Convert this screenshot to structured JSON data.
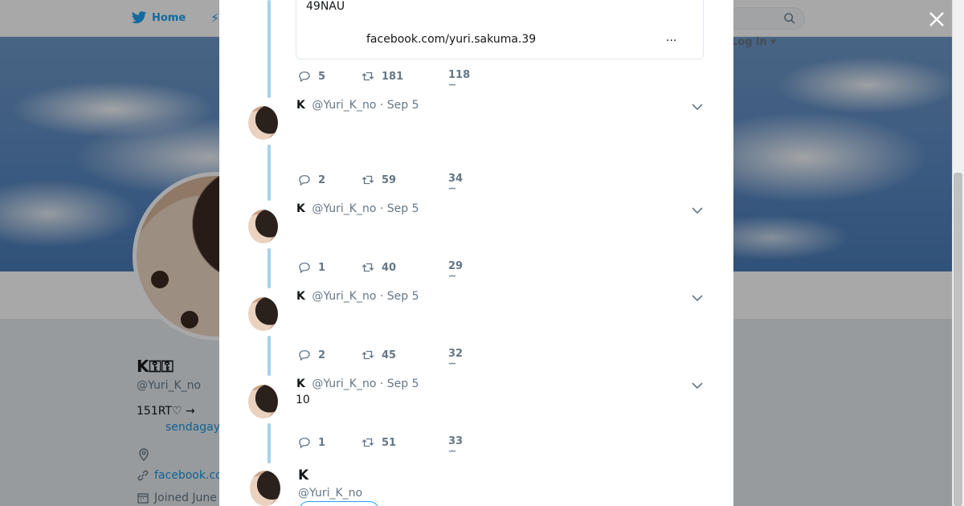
{
  "nav": {
    "home_label": "Home",
    "login_label": "Log in ▾"
  },
  "profile": {
    "name": "K⚿⚿",
    "handle": "@Yuri_K_no",
    "bio": "151RT♡ →",
    "bio_link": "sendagay",
    "url": "facebook.co",
    "joined": "Joined June"
  },
  "card": {
    "text": "49NAU",
    "link": "facebook.com/yuri.sakuma.39",
    "more": "..."
  },
  "tweets": [
    {
      "reply": "5",
      "retweet": "181",
      "like": "118"
    },
    {
      "name": "K",
      "handle": "@Yuri_K_no",
      "dot": "·",
      "date": "Sep 5",
      "body": "",
      "reply": "2",
      "retweet": "59",
      "like": "34"
    },
    {
      "name": "K",
      "handle": "@Yuri_K_no",
      "dot": "·",
      "date": "Sep 5",
      "body": "",
      "reply": "1",
      "retweet": "40",
      "like": "29"
    },
    {
      "name": "K",
      "handle": "@Yuri_K_no",
      "dot": "·",
      "date": "Sep 5",
      "body": "",
      "reply": "2",
      "retweet": "45",
      "like": "32"
    },
    {
      "name": "K",
      "handle": "@Yuri_K_no",
      "dot": "·",
      "date": "Sep 5",
      "body": "10",
      "reply": "1",
      "retweet": "51",
      "like": "33"
    }
  ],
  "footer_profile": {
    "name": "K",
    "handle": "@Yuri_K_no"
  },
  "colors": {
    "accent": "#1da1f2",
    "thread_line": "#a5d2ea",
    "muted": "#657786"
  }
}
